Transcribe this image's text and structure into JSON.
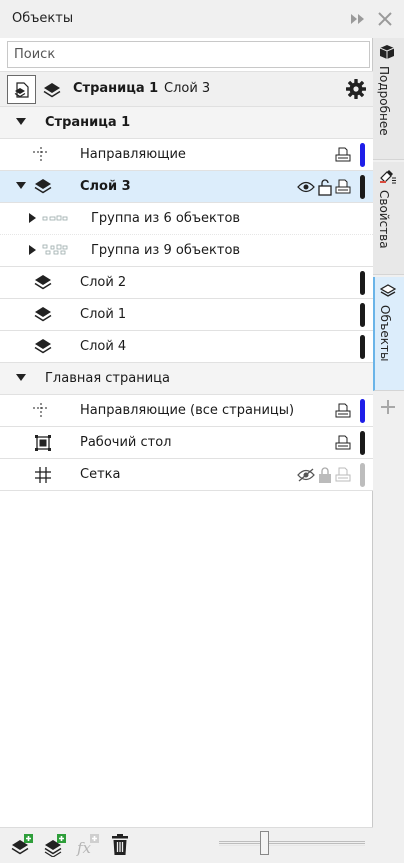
{
  "window": {
    "title": "Объекты"
  },
  "search": {
    "placeholder": "Поиск"
  },
  "toolbar": {
    "current_page": "Страница 1",
    "current_layer": "Слой 3"
  },
  "tree": {
    "page1": {
      "label": "Страница 1",
      "guides": "Направляющие",
      "layer3": "Слой 3",
      "group6": "Группа из 6 объектов",
      "group9": "Группа из 9 объектов",
      "layer2": "Слой 2",
      "layer1": "Слой 1",
      "layer4": "Слой 4"
    },
    "master": {
      "label": "Главная страница",
      "guides_all": "Направляющие (все страницы)",
      "desktop": "Рабочий стол",
      "grid": "Сетка"
    }
  },
  "colors": {
    "guides": "#1e1ee8",
    "layer": "#1a1a1a",
    "grid": "#bdbdbd",
    "selection": "#dcedfb"
  },
  "side_tabs": {
    "details": "Подробнее",
    "properties": "Свойства",
    "objects": "Объекты"
  }
}
